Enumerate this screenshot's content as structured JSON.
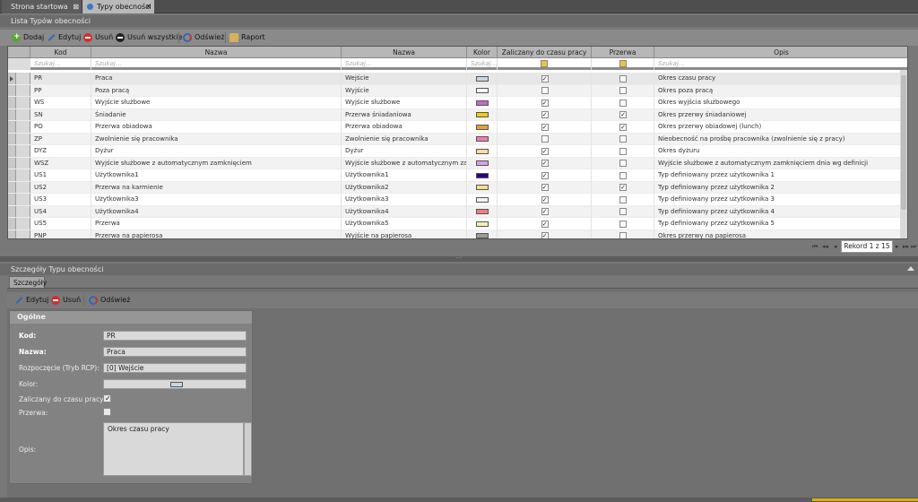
{
  "tabs": [
    {
      "label": "Strona startowa",
      "close": "⊠"
    },
    {
      "label": "Typy obecności",
      "close": "✕"
    }
  ],
  "list_panel": {
    "title": "Lista Typów obecności",
    "toolbar": {
      "add": "Dodaj",
      "edit": "Edytuj",
      "delete": "Usuń",
      "delete_all": "Usuń wszystkie",
      "refresh": "Odśwież",
      "report": "Raport"
    }
  },
  "grid": {
    "columns": [
      "Kod",
      "Nazwa",
      "Nazwa",
      "Kolor",
      "Zaliczany do czasu pracy",
      "Przerwa",
      "Opis"
    ],
    "filter_placeholder": "Szukaj...",
    "rows": [
      {
        "kod": "PR",
        "nazwa": "Praca",
        "nazwa2": "Wejście",
        "kolor": "#c6d7e6",
        "zaliczany": true,
        "przerwa": false,
        "opis": "Okres czasu pracy"
      },
      {
        "kod": "PP",
        "nazwa": "Poza pracą",
        "nazwa2": "Wyjście",
        "kolor": "#f5f5f5",
        "zaliczany": false,
        "przerwa": false,
        "opis": "Okres poza pracą"
      },
      {
        "kod": "WS",
        "nazwa": "Wyjście służbowe",
        "nazwa2": "Wyjście służbowe",
        "kolor": "#c26acb",
        "zaliczany": true,
        "przerwa": false,
        "opis": "Okres wyjścia służbowego"
      },
      {
        "kod": "SN",
        "nazwa": "Śniadanie",
        "nazwa2": "Przerwa śniadaniowa",
        "kolor": "#f2cb12",
        "zaliczany": true,
        "przerwa": true,
        "opis": "Okres przerwy śniadaniowej"
      },
      {
        "kod": "PO",
        "nazwa": "Przerwa obiadowa",
        "nazwa2": "Przerwa obiadowa",
        "kolor": "#e3a235",
        "zaliczany": true,
        "przerwa": true,
        "opis": "Okres przerwy obiadowej (lunch)"
      },
      {
        "kod": "ZP",
        "nazwa": "Zwolnienie się pracownika",
        "nazwa2": "Zwolnienie się pracownika",
        "kolor": "#f07ab0",
        "zaliczany": false,
        "przerwa": false,
        "opis": "Nieobecność na prośbę pracownika (zwolnienie się z pracy)"
      },
      {
        "kod": "DYZ",
        "nazwa": "Dyżur",
        "nazwa2": "Dyżur",
        "kolor": "#f6dcaa",
        "zaliczany": true,
        "przerwa": false,
        "opis": "Okres dyżuru"
      },
      {
        "kod": "WSZ",
        "nazwa": "Wyjście służbowe z automatycznym zamknięciem",
        "nazwa2": "Wyjście służbowe z automatycznym zam...",
        "kolor": "#dea0e0",
        "zaliczany": true,
        "przerwa": false,
        "opis": "Wyjście służbowe z automatycznym zamknięciem dnia wg definicji"
      },
      {
        "kod": "US1",
        "nazwa": "Użytkownika1",
        "nazwa2": "Użytkownika1",
        "kolor": "#2a0080",
        "zaliczany": true,
        "przerwa": false,
        "opis": "Typ definiowany przez użytkownika 1"
      },
      {
        "kod": "US2",
        "nazwa": "Przerwa na karmienie",
        "nazwa2": "Użytkownika2",
        "kolor": "#f5e08a",
        "zaliczany": true,
        "przerwa": true,
        "opis": "Typ definiowany przez użytkownika 2"
      },
      {
        "kod": "US3",
        "nazwa": "Użytkownika3",
        "nazwa2": "Użytkownika3",
        "kolor": "#f3f3f3",
        "zaliczany": true,
        "przerwa": false,
        "opis": "Typ definiowany przez użytkownika 3"
      },
      {
        "kod": "US4",
        "nazwa": "Użytkownika4",
        "nazwa2": "Użytkownika4",
        "kolor": "#f08080",
        "zaliczany": true,
        "przerwa": false,
        "opis": "Typ definiowany przez użytkownika 4"
      },
      {
        "kod": "US5",
        "nazwa": "Przerwa",
        "nazwa2": "Użytkownika5",
        "kolor": "#f8efb8",
        "zaliczany": true,
        "przerwa": false,
        "opis": "Typ definiowany przez użytkownika 5"
      },
      {
        "kod": "PNP",
        "nazwa": "Przerwa na papierosa",
        "nazwa2": "Wyjście na papierosa",
        "kolor": "#9a9a9a",
        "zaliczany": true,
        "przerwa": false,
        "opis": "Okres przerwy na papierosa"
      }
    ]
  },
  "pager": {
    "first": "⏮",
    "prev_page": "◂◂",
    "prev": "◂",
    "record": "Rekord 1 z 15",
    "next": "▸",
    "next_page": "▸▸",
    "last": "⏭"
  },
  "detail_panel": {
    "title": "Szczegóły Typu obecności",
    "tab": "Szczegóły",
    "toolbar": {
      "edit": "Edytuj",
      "delete": "Usuń",
      "refresh": "Odśwież"
    },
    "group_title": "Ogólne",
    "fields": {
      "kod_label": "Kod:",
      "kod_value": "PR",
      "nazwa_label": "Nazwa:",
      "nazwa_value": "Praca",
      "rozpoczecie_label": "Rozpoczęcie (Tryb RCP):",
      "rozpoczecie_value": "[0] Wejście",
      "kolor_label": "Kolor:",
      "kolor_value": "#c6d7e6",
      "zaliczany_label": "Zaliczany do czasu pracy:",
      "zaliczany_value": true,
      "przerwa_label": "Przerwa:",
      "przerwa_value": false,
      "opis_label": "Opis:",
      "opis_value": "Okres czasu pracy"
    }
  }
}
